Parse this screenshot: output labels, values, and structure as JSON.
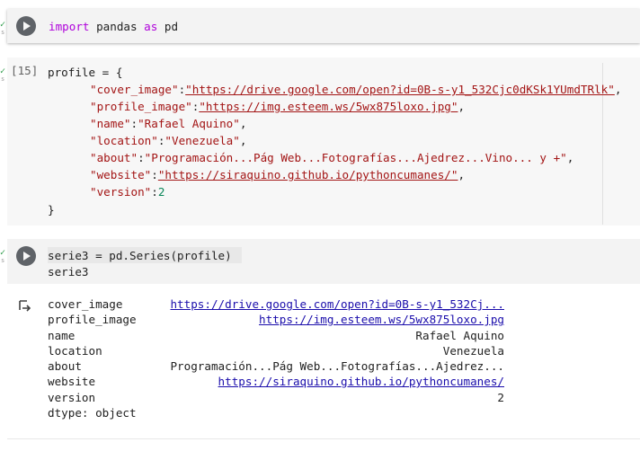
{
  "cell1": {
    "kw_import": "import",
    "mod": " pandas ",
    "kw_as": "as",
    "alias": " pd"
  },
  "cell2": {
    "exec_count": "[15]",
    "line1": "profile = {",
    "cover_key": "\"cover_image\"",
    "cover_colon": ":",
    "cover_val": "\"https://drive.google.com/open?id=0B-s-y1_532Cjc0dKSk1YUmdTRlk\"",
    "cover_tail": ",",
    "profile_key": "\"profile_image\"",
    "profile_colon": ":",
    "profile_val": "\"https://img.esteem.ws/5wx875loxo.jpg\"",
    "profile_tail": ",",
    "name_key": "\"name\"",
    "name_colon": ":",
    "name_val": "\"Rafael Aquino\"",
    "name_tail": ",",
    "location_key": "\"location\"",
    "location_colon": ":",
    "location_val": "\"Venezuela\"",
    "location_tail": ",",
    "about_key": "\"about\"",
    "about_colon": ":",
    "about_val": "\"Programación...Pág Web...Fotografías...Ajedrez...Vino... y +\"",
    "about_tail": ",",
    "website_key": "\"website\"",
    "website_colon": ":",
    "website_val": "\"https://siraquino.github.io/pythoncumanes/\"",
    "website_tail": ",",
    "version_key": "\"version\"",
    "version_colon": ":",
    "version_val": "2",
    "close": "}"
  },
  "cell3": {
    "line1": "serie3 = pd.Series(profile)",
    "line2": "serie3"
  },
  "output": {
    "rows": [
      {
        "key": "cover_image",
        "value": "https://drive.google.com/open?id=0B-s-y1_532Cj..."
      },
      {
        "key": "profile_image",
        "value": "https://img.esteem.ws/5wx875loxo.jpg"
      },
      {
        "key": "name",
        "value": "Rafael Aquino"
      },
      {
        "key": "location",
        "value": "Venezuela"
      },
      {
        "key": "about",
        "value": "Programación...Pág Web...Fotografías...Ajedrez..."
      },
      {
        "key": "website",
        "value": "https://siraquino.github.io/pythoncumanes/"
      },
      {
        "key": "version",
        "value": "2"
      }
    ],
    "dtype": "dtype: object"
  },
  "icons": {
    "run": "play-icon",
    "output": "output-arrow-icon"
  },
  "colors": {
    "keyword": "#af00db",
    "string": "#a31515",
    "number": "#098658",
    "link": "#1a0dab",
    "run_button": "#5f6368"
  }
}
